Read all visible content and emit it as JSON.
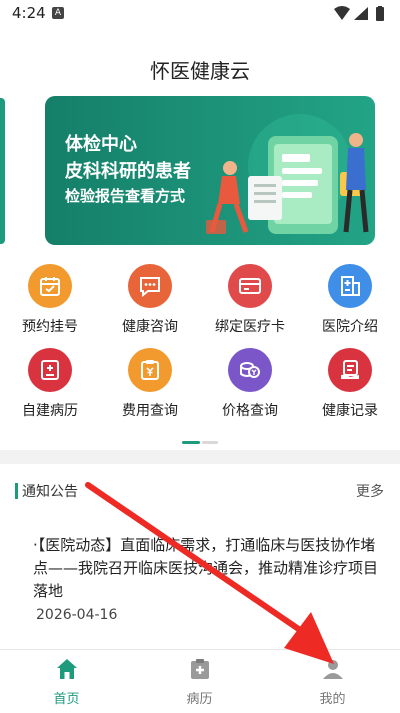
{
  "status_bar": {
    "time": "4:24",
    "notification_letter": "A"
  },
  "header": {
    "title": "怀医健康云"
  },
  "banner": {
    "line1": "体检中心",
    "line2": "皮科科研的患者",
    "line3": "检验报告查看方式"
  },
  "menu": [
    {
      "label": "预约挂号",
      "icon": "calendar-icon",
      "color": "#f29a2e"
    },
    {
      "label": "健康咨询",
      "icon": "chat-icon",
      "color": "#e8653a"
    },
    {
      "label": "绑定医疗卡",
      "icon": "card-icon",
      "color": "#e04a4a"
    },
    {
      "label": "医院介绍",
      "icon": "hospital-icon",
      "color": "#3f8ee8"
    },
    {
      "label": "自建病历",
      "icon": "record-icon",
      "color": "#d8333f"
    },
    {
      "label": "费用查询",
      "icon": "fee-icon",
      "color": "#f29a2e"
    },
    {
      "label": "价格查询",
      "icon": "coins-icon",
      "color": "#7b56c9"
    },
    {
      "label": "健康记录",
      "icon": "health-record-icon",
      "color": "#d8333f"
    }
  ],
  "notice": {
    "title": "通知公告",
    "more": "更多",
    "item_text": "·【医院动态】直面临床需求，打通临床与医技协作堵点——我院召开临床医技沟通会，推动精准诊疗项目落地",
    "item_date": "2026-04-16"
  },
  "tabs": [
    {
      "label": "首页",
      "active": true
    },
    {
      "label": "病历",
      "active": false
    },
    {
      "label": "我的",
      "active": false
    }
  ],
  "colors": {
    "accent": "#1e9a7c",
    "annotation_arrow": "#ee2a24"
  }
}
